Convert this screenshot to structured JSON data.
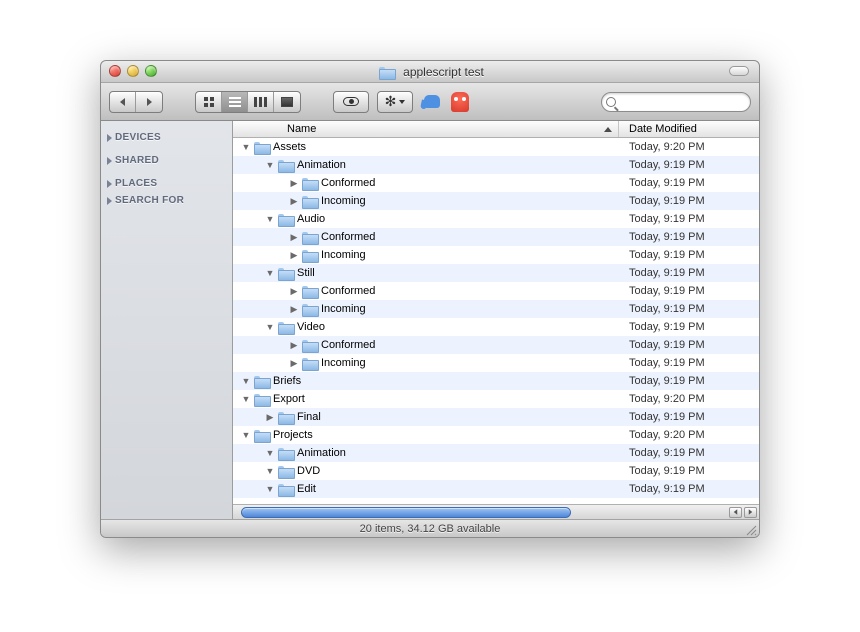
{
  "window": {
    "title": "applescript test"
  },
  "sidebar": {
    "sections": [
      {
        "label": "DEVICES"
      },
      {
        "label": "SHARED"
      },
      {
        "label": "PLACES"
      },
      {
        "label": "SEARCH FOR"
      }
    ]
  },
  "columns": {
    "name": "Name",
    "date": "Date Modified"
  },
  "rows": [
    {
      "name": "Assets",
      "date": "Today, 9:20 PM",
      "depth": 0,
      "expanded": true
    },
    {
      "name": "Animation",
      "date": "Today, 9:19 PM",
      "depth": 1,
      "expanded": true
    },
    {
      "name": "Conformed",
      "date": "Today, 9:19 PM",
      "depth": 2,
      "expanded": false
    },
    {
      "name": "Incoming",
      "date": "Today, 9:19 PM",
      "depth": 2,
      "expanded": false
    },
    {
      "name": "Audio",
      "date": "Today, 9:19 PM",
      "depth": 1,
      "expanded": true
    },
    {
      "name": "Conformed",
      "date": "Today, 9:19 PM",
      "depth": 2,
      "expanded": false
    },
    {
      "name": "Incoming",
      "date": "Today, 9:19 PM",
      "depth": 2,
      "expanded": false
    },
    {
      "name": "Still",
      "date": "Today, 9:19 PM",
      "depth": 1,
      "expanded": true
    },
    {
      "name": "Conformed",
      "date": "Today, 9:19 PM",
      "depth": 2,
      "expanded": false
    },
    {
      "name": "Incoming",
      "date": "Today, 9:19 PM",
      "depth": 2,
      "expanded": false
    },
    {
      "name": "Video",
      "date": "Today, 9:19 PM",
      "depth": 1,
      "expanded": true
    },
    {
      "name": "Conformed",
      "date": "Today, 9:19 PM",
      "depth": 2,
      "expanded": false
    },
    {
      "name": "Incoming",
      "date": "Today, 9:19 PM",
      "depth": 2,
      "expanded": false
    },
    {
      "name": "Briefs",
      "date": "Today, 9:19 PM",
      "depth": 0,
      "expanded": true
    },
    {
      "name": "Export",
      "date": "Today, 9:20 PM",
      "depth": 0,
      "expanded": true
    },
    {
      "name": "Final",
      "date": "Today, 9:19 PM",
      "depth": 1,
      "expanded": false
    },
    {
      "name": "Projects",
      "date": "Today, 9:20 PM",
      "depth": 0,
      "expanded": true
    },
    {
      "name": "Animation",
      "date": "Today, 9:19 PM",
      "depth": 1,
      "expanded": true
    },
    {
      "name": "DVD",
      "date": "Today, 9:19 PM",
      "depth": 1,
      "expanded": true
    },
    {
      "name": "Edit",
      "date": "Today, 9:19 PM",
      "depth": 1,
      "expanded": true
    }
  ],
  "status": "20 items, 34.12 GB available"
}
